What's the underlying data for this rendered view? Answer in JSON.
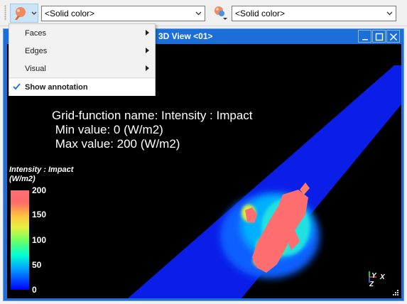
{
  "toolbar": {
    "face_color_icon": "face-color-picker-icon",
    "face_color_combo": "<Solid color>",
    "edge_color_icon": "edge-color-picker-icon",
    "edge_color_combo": "<Solid color>"
  },
  "window": {
    "title": "3D View <01>",
    "buttons": [
      "minimize",
      "maximize",
      "close"
    ]
  },
  "annotation": {
    "line1": "Grid-function name: Intensity : Impact",
    "line2": " Min value: 0 (W/m2)",
    "line3": " Max value: 200 (W/m2)"
  },
  "legend": {
    "title_line1": "Intensity : Impact",
    "title_line2": "(W/m2)",
    "ticks": [
      "200",
      "150",
      "100",
      "50",
      "0"
    ],
    "colors": {
      "low": "#0000ff",
      "high": "#ff6e6e"
    }
  },
  "axes": {
    "x": "X",
    "y": "Y",
    "z": "Z"
  },
  "context_menu": {
    "items": [
      {
        "label": "Faces",
        "submenu": true
      },
      {
        "label": "Edges",
        "submenu": true
      },
      {
        "label": "Visual",
        "submenu": true
      },
      {
        "label": "Show annotation",
        "checked": true
      }
    ]
  }
}
